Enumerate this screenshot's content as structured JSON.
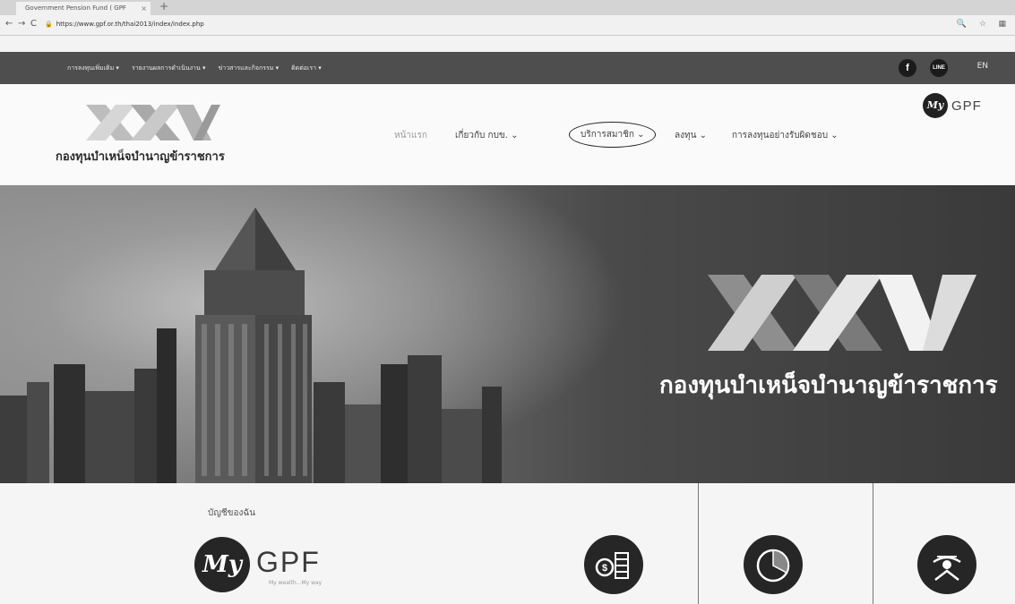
{
  "browser": {
    "tab_title": "Government Pension Fund ( GPF",
    "tab_close": "×",
    "new_tab": "+",
    "url": "https://www.gpf.or.th/thai2013/index/index.php",
    "back": "←",
    "forward": "→",
    "reload": "C"
  },
  "topbar": {
    "menu": [
      "การลงทุนเพิ่มเติม ▾",
      "รายงานผลการดำเนินงาน ▾",
      "ข่าวสารและกิจกรรม ▾",
      "ติดต่อเรา ▾"
    ],
    "facebook": "f",
    "line": "LINE",
    "language": "EN"
  },
  "header": {
    "logo_text": "กองทุนบำเหน็จบำนาญข้าราชการ",
    "nav": {
      "home": "หน้าแรก",
      "about": "เกี่ยวกับ กบข. ⌄",
      "member_services": "บริการสมาชิก ⌄",
      "invest": "ลงทุน ⌄",
      "responsible": "การลงทุนอย่างรับผิดชอบ ⌄"
    },
    "mygpf_my": "My",
    "mygpf_gpf": "GPF"
  },
  "hero": {
    "title": "กองทุนบำเหน็จบำนาญข้าราชการ"
  },
  "lower": {
    "account_label": "บัญชีของฉัน",
    "my": "My",
    "gpf": "GPF",
    "tagline": "My wealth...My way"
  },
  "colors": {
    "topbar_bg": "#4e4e4e",
    "hero_text": "#ffffff",
    "icon_bg": "#262626"
  }
}
